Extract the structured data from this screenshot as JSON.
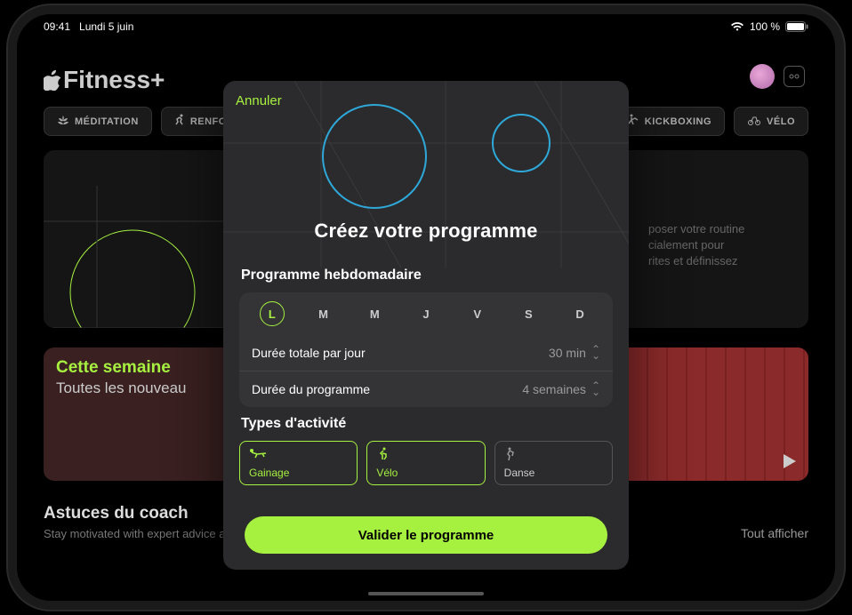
{
  "status": {
    "time": "09:41",
    "date": "Lundi 5 juin",
    "battery_pct": "100 %"
  },
  "app": {
    "logo_text": "Fitness+",
    "categories": {
      "meditation": "MÉDITATION",
      "renforcement_trunc": "RENFO",
      "kickboxing": "KICKBOXING",
      "velo": "VÉLO"
    },
    "hero_desc_line1": "poser votre routine",
    "hero_desc_line2": "cialement pour",
    "hero_desc_line3": "rites et définissez",
    "week": {
      "title": "Cette semaine",
      "subtitle": "Toutes les nouveau"
    },
    "coach": {
      "title": "Astuces du coach",
      "subtitle": "Stay motivated with expert advice and how-to demos from the Fitness+ trainer team",
      "show_all": "Tout afficher"
    }
  },
  "modal": {
    "cancel": "Annuler",
    "title": "Créez votre programme",
    "schedule_label": "Programme hebdomadaire",
    "days": [
      "L",
      "M",
      "M",
      "J",
      "V",
      "S",
      "D"
    ],
    "active_day_index": 0,
    "row1_label": "Durée totale par jour",
    "row1_value": "30 min",
    "row2_label": "Durée du programme",
    "row2_value": "4 semaines",
    "activities_label": "Types d'activité",
    "activities": [
      {
        "name": "Gainage",
        "selected": true
      },
      {
        "name": "Vélo",
        "selected": true
      },
      {
        "name": "Danse",
        "selected": false
      }
    ],
    "submit": "Valider le programme"
  }
}
